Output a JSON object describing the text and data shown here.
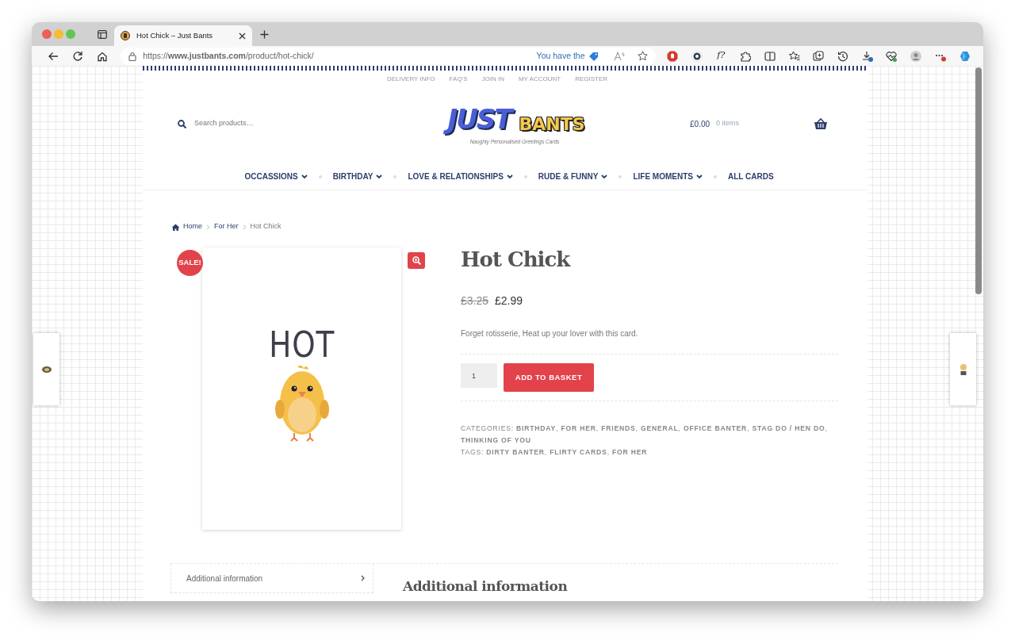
{
  "browser": {
    "tab_title": "Hot Chick – Just Bants",
    "url": "https://**www.justbants.com**/product/hot-chick/",
    "address_notice": "You have the",
    "extension_label": "f?"
  },
  "top_links": [
    "DELIVERY INFO",
    "FAQ'S",
    "JOIN IN",
    "MY ACCOUNT",
    "REGISTER"
  ],
  "search": {
    "placeholder": "Search products…"
  },
  "logo": {
    "word_1": "JUST",
    "word_2": "BANTS",
    "tagline": "Naughty Personalised Greetings Cards"
  },
  "cart": {
    "total": "£0.00",
    "count": "0 items"
  },
  "nav": [
    {
      "label": "OCCASSIONS",
      "dropdown": true
    },
    {
      "label": "BIRTHDAY",
      "dropdown": true
    },
    {
      "label": "LOVE & RELATIONSHIPS",
      "dropdown": true
    },
    {
      "label": "RUDE & FUNNY",
      "dropdown": true
    },
    {
      "label": "LIFE MOMENTS",
      "dropdown": true
    },
    {
      "label": "ALL CARDS",
      "dropdown": false
    }
  ],
  "breadcrumb": [
    {
      "label": "Home",
      "kind": "home"
    },
    {
      "label": "For Her",
      "kind": "link"
    },
    {
      "label": "Hot Chick",
      "kind": "current"
    }
  ],
  "product": {
    "sale_badge": "SALE!",
    "card_text": "HOT",
    "title": "Hot Chick",
    "old_price": "£3.25",
    "price": "£2.99",
    "description": "Forget rotisserie, Heat up your lover with this card.",
    "quantity": "1",
    "add_button": "ADD TO BASKET",
    "separator": ",",
    "categories_label": "CATEGORIES:",
    "categories": [
      "BIRTHDAY",
      "FOR HER",
      "FRIENDS",
      "GENERAL",
      "OFFICE BANTER",
      "STAG DO / HEN DO",
      "THINKING OF YOU"
    ],
    "tags_label": "TAGS:",
    "tags": [
      "DIRTY BANTER",
      "FLIRTY CARDS",
      "FOR HER"
    ]
  },
  "tabs": [
    {
      "label": "Additional information"
    }
  ],
  "panel": {
    "heading": "Additional information"
  }
}
